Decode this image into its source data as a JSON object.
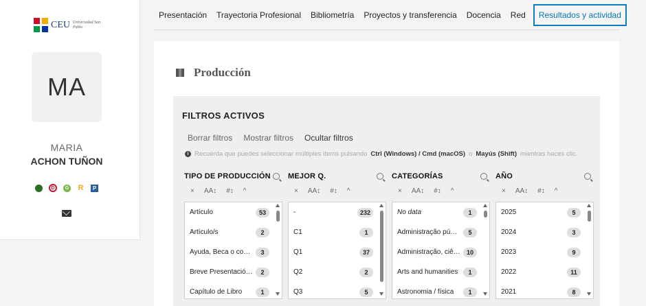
{
  "logo": {
    "brand": "CEU",
    "subtitle": "Universidad San Pablo"
  },
  "profile": {
    "initials": "MA",
    "first_name": "MARIA",
    "last_name": "ACHON TUÑON",
    "icons": [
      "orcid-icon",
      "dialnet-icon",
      "google-scholar-icon",
      "researchgate-icon",
      "publons-icon"
    ]
  },
  "nav": {
    "tabs": [
      {
        "label": "Presentación"
      },
      {
        "label": "Trayectoria Profesional"
      },
      {
        "label": "Bibliometría"
      },
      {
        "label": "Proyectos y transferencia"
      },
      {
        "label": "Docencia"
      },
      {
        "label": "Red"
      },
      {
        "label": "Resultados y actividad",
        "active": true
      }
    ]
  },
  "section": {
    "title": "Producción"
  },
  "filters": {
    "title": "FILTROS ACTIVOS",
    "borrar": "Borrar filtros",
    "mostrar": "Mostrar filtros",
    "ocultar": "Ocultar filtros",
    "hint_prefix": "Recuerda que puedes seleccionar múltiples ítems pulsando",
    "hint_keys1": "Ctrl (Windows) / Cmd (macOS)",
    "hint_or": "o",
    "hint_keys2": "Mayús (Shift)",
    "hint_suffix": "mientras haces clic."
  },
  "tools": {
    "clear": "×",
    "sort_alpha": "AA↕",
    "sort_num": "#↕",
    "collapse": "^"
  },
  "columns": [
    {
      "title": "TIPO DE PRODUCCIÓN",
      "items": [
        {
          "label": "Artículo",
          "count": "53"
        },
        {
          "label": "Artículo/s",
          "count": "2"
        },
        {
          "label": "Ayuda, Beca o contrato",
          "count": "3"
        },
        {
          "label": "Breve Presentación Oral",
          "count": "2"
        },
        {
          "label": "Capítulo de Libro",
          "count": "1"
        }
      ]
    },
    {
      "title": "MEJOR Q.",
      "items": [
        {
          "label": "-",
          "count": "232"
        },
        {
          "label": "C1",
          "count": "1"
        },
        {
          "label": "Q1",
          "count": "37"
        },
        {
          "label": "Q2",
          "count": "2"
        },
        {
          "label": "Q3",
          "count": "5"
        }
      ]
    },
    {
      "title": "CATEGORÍAS",
      "items": [
        {
          "label": "No data",
          "count": "1",
          "italic": true
        },
        {
          "label": "Administração pública",
          "count": "5"
        },
        {
          "label": "Administração, ciências",
          "count": "10"
        },
        {
          "label": "Arts and humanities",
          "count": "1"
        },
        {
          "label": "Astronomia / física",
          "count": "1"
        }
      ]
    },
    {
      "title": "AÑO",
      "items": [
        {
          "label": "2025",
          "count": "5"
        },
        {
          "label": "2024",
          "count": "3"
        },
        {
          "label": "2023",
          "count": "9"
        },
        {
          "label": "2022",
          "count": "11"
        },
        {
          "label": "2021",
          "count": "8"
        }
      ]
    }
  ]
}
